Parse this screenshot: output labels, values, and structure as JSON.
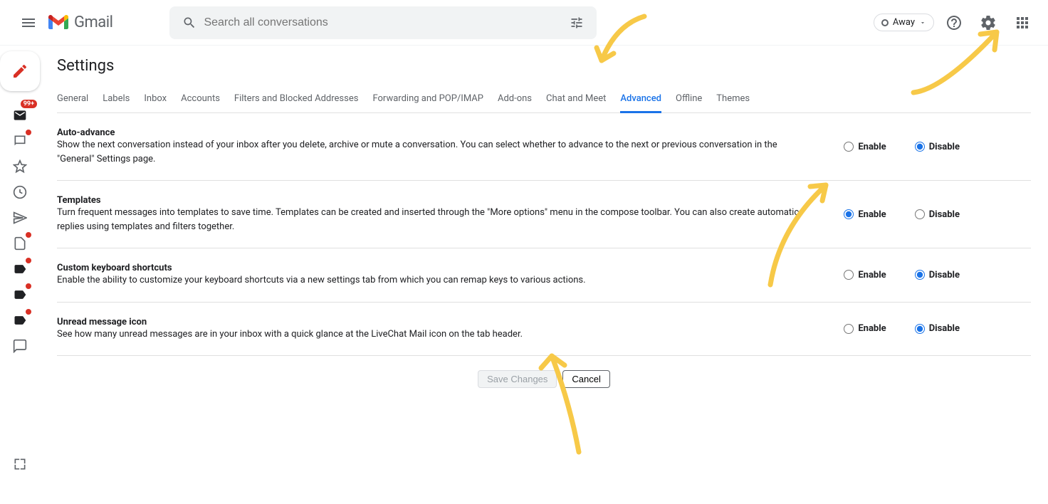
{
  "header": {
    "logo_text": "Gmail",
    "search_placeholder": "Search all conversations",
    "status_label": "Away"
  },
  "sidebar": {
    "inbox_badge": "99+"
  },
  "page": {
    "title": "Settings"
  },
  "tabs": [
    {
      "label": "General",
      "active": false
    },
    {
      "label": "Labels",
      "active": false
    },
    {
      "label": "Inbox",
      "active": false
    },
    {
      "label": "Accounts",
      "active": false
    },
    {
      "label": "Filters and Blocked Addresses",
      "active": false
    },
    {
      "label": "Forwarding and POP/IMAP",
      "active": false
    },
    {
      "label": "Add-ons",
      "active": false
    },
    {
      "label": "Chat and Meet",
      "active": false
    },
    {
      "label": "Advanced",
      "active": true
    },
    {
      "label": "Offline",
      "active": false
    },
    {
      "label": "Themes",
      "active": false
    }
  ],
  "settings": [
    {
      "title": "Auto-advance",
      "description": "Show the next conversation instead of your inbox after you delete, archive or mute a conversation. You can select whether to advance to the next or previous conversation in the \"General\" Settings page.",
      "selected": "disable"
    },
    {
      "title": "Templates",
      "description": "Turn frequent messages into templates to save time. Templates can be created and inserted through the \"More options\" menu in the compose toolbar. You can also create automatic replies using templates and filters together.",
      "selected": "enable"
    },
    {
      "title": "Custom keyboard shortcuts",
      "description": "Enable the ability to customize your keyboard shortcuts via a new settings tab from which you can remap keys to various actions.",
      "selected": "disable"
    },
    {
      "title": "Unread message icon",
      "description": "See how many unread messages are in your inbox with a quick glance at the LiveChat Mail icon on the tab header.",
      "selected": "disable"
    }
  ],
  "radio_labels": {
    "enable": "Enable",
    "disable": "Disable"
  },
  "buttons": {
    "save": "Save Changes",
    "cancel": "Cancel"
  }
}
